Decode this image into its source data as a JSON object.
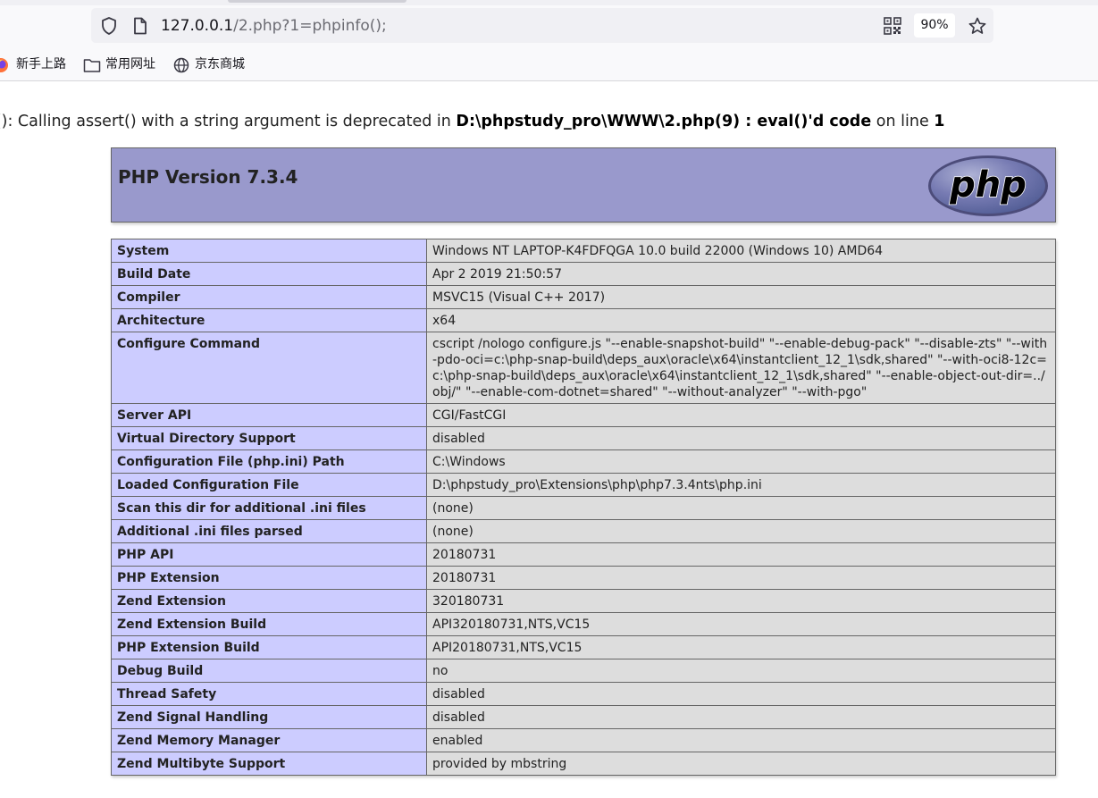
{
  "browser": {
    "url_host": "127.0.0.1",
    "url_path": "/2.php?1=phpinfo();",
    "zoom": "90%",
    "bookmarks": [
      {
        "label": "新手上路"
      },
      {
        "label": "常用网址"
      },
      {
        "label": "京东商城"
      }
    ]
  },
  "warning": {
    "prefix": "ert(): Calling assert() with a string argument is deprecated in ",
    "file": "D:\\phpstudy_pro\\WWW\\2.php(9) : eval()'d code",
    "middle": " on line ",
    "line": "1"
  },
  "header": {
    "title": "PHP Version 7.3.4",
    "logo_text": "php",
    "bg_color": "#9999cc"
  },
  "rows": [
    {
      "key": "System",
      "value": "Windows NT LAPTOP-K4FDFQGA 10.0 build 22000 (Windows 10) AMD64"
    },
    {
      "key": "Build Date",
      "value": "Apr 2 2019 21:50:57"
    },
    {
      "key": "Compiler",
      "value": "MSVC15 (Visual C++ 2017)"
    },
    {
      "key": "Architecture",
      "value": "x64"
    },
    {
      "key": "Configure Command",
      "value": "cscript /nologo configure.js \"--enable-snapshot-build\" \"--enable-debug-pack\" \"--disable-zts\" \"--with-pdo-oci=c:\\php-snap-build\\deps_aux\\oracle\\x64\\instantclient_12_1\\sdk,shared\" \"--with-oci8-12c=c:\\php-snap-build\\deps_aux\\oracle\\x64\\instantclient_12_1\\sdk,shared\" \"--enable-object-out-dir=../obj/\" \"--enable-com-dotnet=shared\" \"--without-analyzer\" \"--with-pgo\""
    },
    {
      "key": "Server API",
      "value": "CGI/FastCGI"
    },
    {
      "key": "Virtual Directory Support",
      "value": "disabled"
    },
    {
      "key": "Configuration File (php.ini) Path",
      "value": "C:\\Windows"
    },
    {
      "key": "Loaded Configuration File",
      "value": "D:\\phpstudy_pro\\Extensions\\php\\php7.3.4nts\\php.ini"
    },
    {
      "key": "Scan this dir for additional .ini files",
      "value": "(none)"
    },
    {
      "key": "Additional .ini files parsed",
      "value": "(none)"
    },
    {
      "key": "PHP API",
      "value": "20180731"
    },
    {
      "key": "PHP Extension",
      "value": "20180731"
    },
    {
      "key": "Zend Extension",
      "value": "320180731"
    },
    {
      "key": "Zend Extension Build",
      "value": "API320180731,NTS,VC15"
    },
    {
      "key": "PHP Extension Build",
      "value": "API20180731,NTS,VC15"
    },
    {
      "key": "Debug Build",
      "value": "no"
    },
    {
      "key": "Thread Safety",
      "value": "disabled"
    },
    {
      "key": "Zend Signal Handling",
      "value": "disabled"
    },
    {
      "key": "Zend Memory Manager",
      "value": "enabled"
    },
    {
      "key": "Zend Multibyte Support",
      "value": "provided by mbstring"
    }
  ]
}
